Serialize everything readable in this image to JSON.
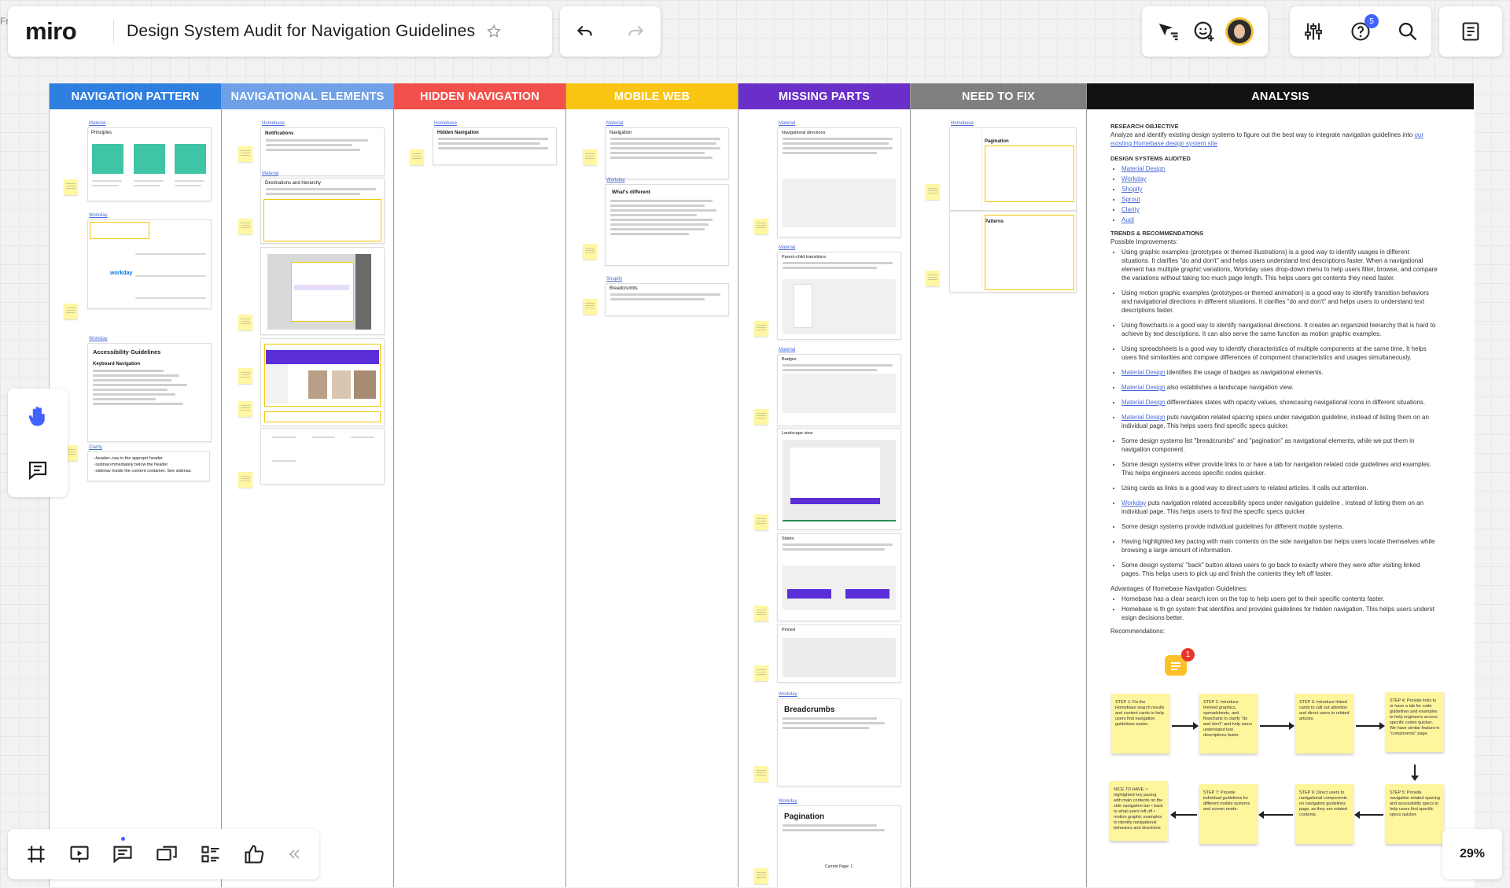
{
  "app": {
    "logo": "miro",
    "board_title": "Design System Audit for Navigation Guidelines",
    "collaborator_count": "5",
    "zoom": "29%",
    "comment_count": "1",
    "edge_label": "Fr"
  },
  "columns": [
    {
      "label": "NAVIGATION PATTERN",
      "color": "#2f7fe0"
    },
    {
      "label": "NAVIGATIONAL ELEMENTS",
      "color": "#6fa0e8"
    },
    {
      "label": "HIDDEN NAVIGATION",
      "color": "#f2504a"
    },
    {
      "label": "MOBILE WEB",
      "color": "#f9c512"
    },
    {
      "label": "MISSING PARTS",
      "color": "#6a2fc8"
    },
    {
      "label": "NEED TO FIX",
      "color": "#7f7f7f"
    },
    {
      "label": "ANALYSIS",
      "color": "#111111"
    }
  ],
  "cards": {
    "nav_pattern": {
      "link1": "Material",
      "principles": "Principles",
      "link2": "Workday",
      "link3": "Workday",
      "accessibility_title": "Accessibility Guidelines",
      "keyboard_nav": "Keyboard Navigation",
      "link4": "Clarity",
      "clarity_lines": [
        "‹header›-nav in the appropri  header",
        "‹subnav›mmediately below the header",
        "‹sidenav inside the content container. See sidenav."
      ]
    },
    "nav_elements": {
      "link1": "Homebase",
      "notifications": "Notifications",
      "link2": "Material",
      "destinations": "Destinations and hierarchy"
    },
    "hidden_nav": {
      "link1": "Homebase",
      "title": "Hidden Navigation"
    },
    "mobile_web": {
      "link1": "Material",
      "navigation": "Navigation",
      "link2": "Workday",
      "whats_different": "What's different",
      "link3": "Shopify",
      "breadcrumbs_small": "Breadcrumbs"
    },
    "missing_parts": {
      "link1": "Material",
      "nav_directions": "Navigational directions",
      "link2": "Material",
      "parent_child": "Parent-child transitions",
      "link3": "Material",
      "badges": "Badges",
      "landscape": "Landscape view",
      "states": "States",
      "pinned": "Pinned",
      "link4": "Workday",
      "breadcrumbs": "Breadcrumbs",
      "link5": "Workday",
      "pagination": "Pagination",
      "pagination_footer": "Current Page: 1"
    },
    "need_to_fix": {
      "link1": "Homebase",
      "pagination": "Pagination",
      "patterns": "Patterns"
    }
  },
  "analysis": {
    "research_objective_title": "RESEARCH OBJECTIVE",
    "research_objective_text": "Analyze and identify existing design systems to figure out the best way to integrate navigation guidelines into",
    "research_objective_link": "our existing Homebase design system site",
    "design_systems_title": "DESIGN SYSTEMS AUDITED",
    "design_systems": [
      "Material Design",
      "Workday",
      "Shopify",
      "Sprout",
      "Clarity",
      "Audi"
    ],
    "trends_title": "TRENDS & RECOMMENDATIONS",
    "possible_improvements": "Possible Improvements:",
    "improvements": [
      {
        "text": "Using graphic examples (prototypes or themed illustrations) is a good way to identify usages in different situations. It clarifies \"do and don't\" and helps users understand text descriptions faster. When a navigational element has multiple graphic variations, Workday uses drop-down menu to help users filter, browse, and compare the variations without taking too much page length. This helps users get contents they need faster."
      },
      {
        "text": "Using motion graphic examples (prototypes or themed animation) is a good way to identify transition behaviors and navigational directions in different situations. It clarifies \"do and don't\" and helps users to understand text descriptions faster."
      },
      {
        "text": "Using flowcharts is a good way to identify navigational directions. It creates an organized hierarchy that is hard to achieve by text descriptions. It can also serve the same function as motion graphic examples."
      },
      {
        "text": "Using spreadsheets is a good way to identify characteristics of multiple components at the same time. It helps users find similarities and compare differences of component characteristics and usages simultaneously."
      },
      {
        "link": "Material Design",
        "text": " identifies the usage of badges as navigational elements."
      },
      {
        "link": "Material Design",
        "text": " also establishes a landscape navigation view."
      },
      {
        "link": "Material Design",
        "text": " differentiates states with opacity values, showcasing navigational icons in different situations."
      },
      {
        "link": "Material Design",
        "text": " puts navigation related spacing specs under navigation guideline, instead of listing them on an individual page. This helps users find specific specs quicker."
      },
      {
        "text": "Some design systems list \"breadcrumbs\" and \"pagination\" as navigational elements, while we put them in navigation component."
      },
      {
        "text": "Some design systems either provide links to or have a tab for navigation related code guidelines and examples. This helps engineers access specific codes quicker."
      },
      {
        "text": "Using cards as links is a good way to direct users to related articles. It calls out attention."
      },
      {
        "link": "Workday",
        "text": " puts navigation related accessibility specs under navigation guideline , instead of listing them on an individual page. This helps users to find the specific specs quicker."
      },
      {
        "text": "Some design systems provide individual guidelines for different mobile systems."
      },
      {
        "text": "Having highlighted key pacing with main contents on the side navigation bar helps users locate themselves while browsing a large amount of information."
      },
      {
        "text": "Some design systems' \"back\" button allows users to go back to exactly where they were after visiting linked pages. This helps users to pick up and finish the contents they left off faster."
      }
    ],
    "advantages_title": "Advantages of Homebase Navigation Guidelines:",
    "advantages": [
      "Homebase has a clear search icon on the top to help users get to their specific contents faster.",
      "Homebase is th      gn system that identifies and provides guidelines for hidden navigation. This helps users underst         esign decisions better."
    ],
    "recommendations_title": "Recommendations:",
    "steps": [
      "STEP 1: Fix the Homebase search results and content cards to help users find navigation guidelines easier.",
      "STEP 2: Introduce themed graphics, spreadsheets, and flowcharts to clarify \"do and don't\" and help users understand text descriptions faster.",
      "STEP 3: Introduce linked cards to call out attention and direct users to related articles.",
      "STEP 4: Provide links to or have a tab for code guidelines and examples to help engineers access specific codes quicker. We have similar feature in \"components\" page.",
      "STEP 5: Provide navigation related spacing and accessibility specs to help users find specific specs quicker.",
      "STEP 6: Direct users to navigational components on navigation guidelines page, as they are related contents.",
      "STEP 7: Provide individual guidelines for different mobile systems and screen mode.",
      "NICE TO HAVE: • highlighted key pacing with main contents on the side navigation bar • back to what users left off • motion graphic examples to identify navigational behaviors and directions"
    ]
  }
}
